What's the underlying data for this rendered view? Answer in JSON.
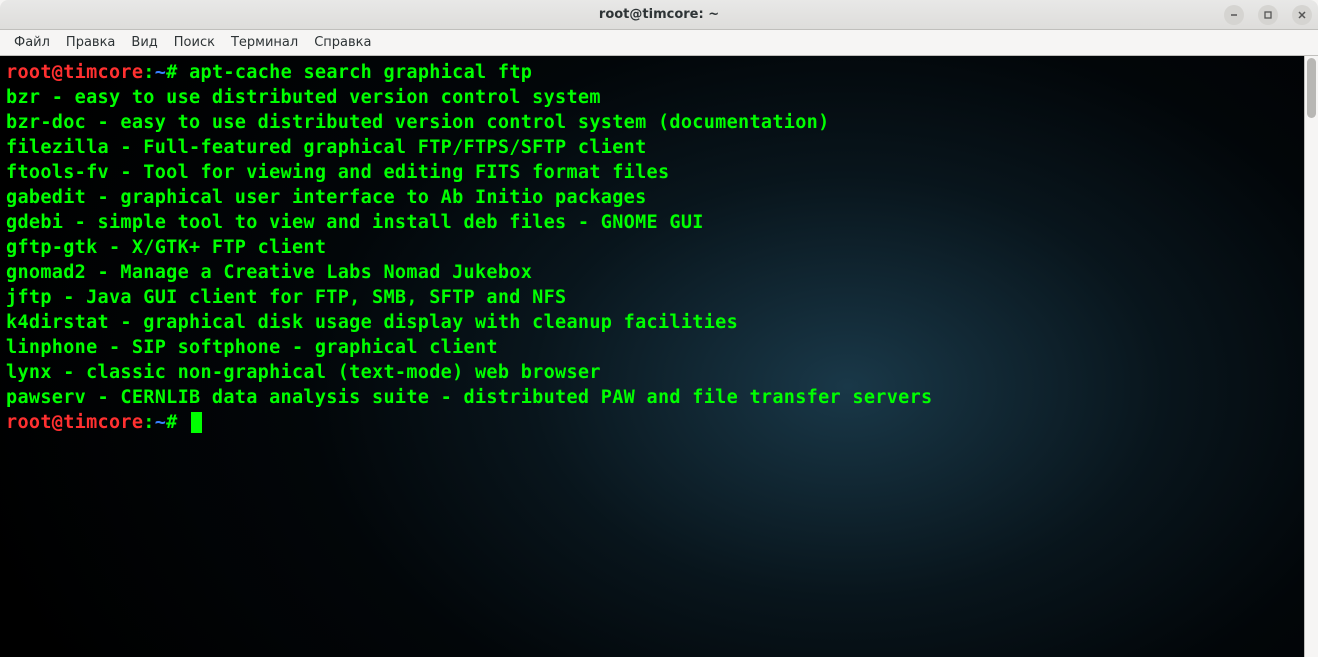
{
  "window": {
    "title": "root@timcore: ~"
  },
  "menubar": {
    "items": [
      "Файл",
      "Правка",
      "Вид",
      "Поиск",
      "Терминал",
      "Справка"
    ]
  },
  "terminal": {
    "prompt": {
      "user_host": "root@timcore",
      "separator": ":",
      "path": "~",
      "symbol": "#"
    },
    "command": "apt-cache search graphical ftp",
    "output": [
      "bzr - easy to use distributed version control system",
      "bzr-doc - easy to use distributed version control system (documentation)",
      "filezilla - Full-featured graphical FTP/FTPS/SFTP client",
      "ftools-fv - Tool for viewing and editing FITS format files",
      "gabedit - graphical user interface to Ab Initio packages",
      "gdebi - simple tool to view and install deb files - GNOME GUI",
      "gftp-gtk - X/GTK+ FTP client",
      "gnomad2 - Manage a Creative Labs Nomad Jukebox",
      "jftp - Java GUI client for FTP, SMB, SFTP and NFS",
      "k4dirstat - graphical disk usage display with cleanup facilities",
      "linphone - SIP softphone - graphical client",
      "lynx - classic non-graphical (text-mode) web browser",
      "pawserv - CERNLIB data analysis suite - distributed PAW and file transfer servers"
    ]
  }
}
